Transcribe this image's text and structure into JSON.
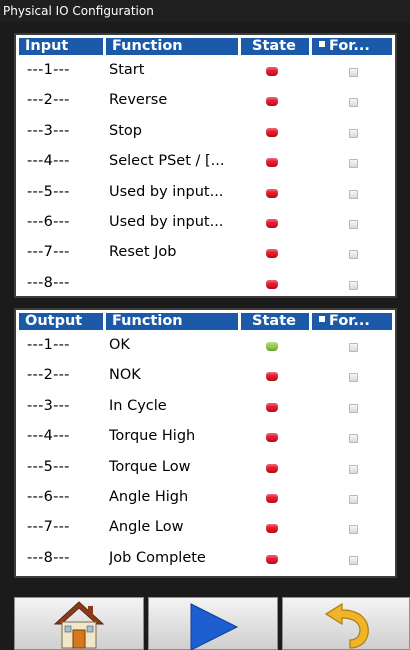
{
  "window": {
    "title": "Physical IO Configuration"
  },
  "inputs": {
    "headers": {
      "name": "Input",
      "function": "Function",
      "state": "State",
      "force": "For..."
    },
    "rows": [
      {
        "num": "---1---",
        "function": "Start",
        "state": "off"
      },
      {
        "num": "---2---",
        "function": "Reverse",
        "state": "off"
      },
      {
        "num": "---3---",
        "function": "Stop",
        "state": "off"
      },
      {
        "num": "---4---",
        "function": "Select PSet / [...",
        "state": "off"
      },
      {
        "num": "---5---",
        "function": "Used by input...",
        "state": "off"
      },
      {
        "num": "---6---",
        "function": "Used by input...",
        "state": "off"
      },
      {
        "num": "---7---",
        "function": "Reset Job",
        "state": "off"
      },
      {
        "num": "---8---",
        "function": "",
        "state": "off"
      }
    ]
  },
  "outputs": {
    "headers": {
      "name": "Output",
      "function": "Function",
      "state": "State",
      "force": "For..."
    },
    "rows": [
      {
        "num": "---1---",
        "function": "OK",
        "state": "on"
      },
      {
        "num": "---2---",
        "function": "NOK",
        "state": "off"
      },
      {
        "num": "---3---",
        "function": "In Cycle",
        "state": "off"
      },
      {
        "num": "---4---",
        "function": "Torque High",
        "state": "off"
      },
      {
        "num": "---5---",
        "function": "Torque Low",
        "state": "off"
      },
      {
        "num": "---6---",
        "function": "Angle High",
        "state": "off"
      },
      {
        "num": "---7---",
        "function": "Angle Low",
        "state": "off"
      },
      {
        "num": "---8---",
        "function": "Job Complete",
        "state": "off"
      }
    ]
  },
  "colors": {
    "header_bg": "#1a5aa8",
    "led_off": "#e8162a",
    "led_on": "#8fd14a",
    "play_icon": "#1d5fd1",
    "undo_icon": "#f0b428",
    "home_roof": "#8c3b1a"
  },
  "toolbar": {
    "buttons": [
      {
        "icon": "home-icon"
      },
      {
        "icon": "play-icon"
      },
      {
        "icon": "undo-icon"
      }
    ]
  }
}
